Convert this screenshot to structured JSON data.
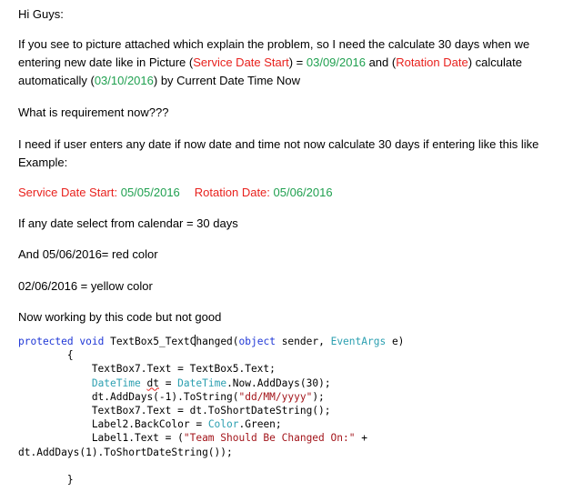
{
  "post": {
    "greeting": "Hi Guys:",
    "intro": {
      "l1": "If you see to picture attached which explain the problem, so I need the calculate 30 days when we",
      "l2_a": "entering new date like in Picture (",
      "l2_b": "Service Date Start",
      "l2_c": ") = ",
      "l2_d": "03/09/2016",
      "l2_e": "  and (",
      "l2_f": "Rotation Date",
      "l2_g": ") calculate",
      "l3_a": "automatically (",
      "l3_b": "03/10/2016",
      "l3_c": ")  by Current Date Time Now"
    },
    "question": "What is requirement now???",
    "need": {
      "l1": "I need if user enters any date if now date and time not now calculate  30 days if entering like this like",
      "l2": "Example:"
    },
    "example": {
      "label1": "Service Date Start:",
      "value1": " 05/05/2016",
      "label2": "Rotation Date:",
      "value2": " 05/06/2016"
    },
    "calendar_rule": "If any date select from calendar = 30  days",
    "red_rule": "And 05/06/2016=  red color",
    "yellow_rule": "02/06/2016  = yellow color",
    "working": "Now working by this code but not good"
  },
  "code": {
    "l1_kw1": "protected",
    "l1_kw2": "void",
    "l1_name_a": "TextBox5_TextC",
    "l1_name_b": "hanged(",
    "l1_kw3": "object",
    "l1_p1": " sender, ",
    "l1_ty": "EventArgs",
    "l1_p2": " e)",
    "l2": "        {",
    "l3": "            TextBox7.Text = TextBox5.Text;",
    "l4_ty1": "DateTime",
    "l4_var": "dt",
    "l4_eq": " = ",
    "l4_ty2": "DateTime",
    "l4_rest": ".Now.AddDays(30);",
    "l5_a": "            dt.AddDays(-1).ToString(",
    "l5_str": "\"dd/MM/yyyy\"",
    "l5_b": ");",
    "l6": "            TextBox7.Text = dt.ToShortDateString();",
    "l7_a": "            Label2.BackColor = ",
    "l7_ty": "Color",
    "l7_b": ".Green;",
    "l8_a": "            Label1.Text = (",
    "l8_str": "\"Team Should Be Changed On:\"",
    "l8_b": " +",
    "l9": "dt.AddDays(1).ToShortDateString());",
    "l10": "",
    "l11": "        }"
  },
  "colors": {
    "red": "#e8211d",
    "green": "#20a050",
    "keyword": "#1f37d6",
    "type": "#2b9fb0",
    "string": "#a3151b"
  }
}
